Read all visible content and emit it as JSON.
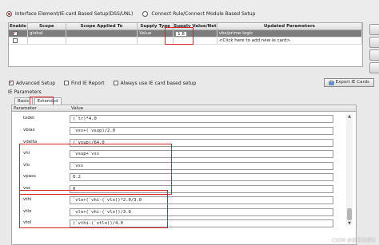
{
  "mode": {
    "option1_label": "Interface Element/IE-card Based Setup(DSS/UNL)",
    "option2_label": "Connect Rule/Connect Module Based Setup",
    "selected": "option1"
  },
  "supply_table": {
    "columns": [
      "Enable",
      "Scope",
      "Scope Applied To",
      "Supply Type",
      "Supply Value/Net",
      "Updated Parameters"
    ],
    "rows": [
      {
        "enabled": true,
        "scope": "global",
        "applied_to": "",
        "type": "Value",
        "value": "1.8",
        "updated": "vbs/prime-logic"
      },
      {
        "enabled": false,
        "scope": "",
        "applied_to": "",
        "type": "",
        "value": "",
        "updated": "<Click here to add new ie card>"
      }
    ]
  },
  "options": {
    "advanced_setup_label": "Advanced Setup",
    "advanced_setup_checked": true,
    "find_ie_report_label": "Find IE Report",
    "find_ie_report_checked": false,
    "always_use_ie_card_label": "Always use IE card based setup",
    "always_use_ie_card_checked": false,
    "export_button_label": "Export IE Cards"
  },
  "ie_parameters": {
    "section_label": "IE Parameters",
    "tabs": [
      "Basic",
      "Extended"
    ],
    "active_tab": "Extended",
    "col_parameter": "Parameter",
    "col_value": "Value",
    "rows": [
      {
        "name": "txdel",
        "value": "(`tr)*4.0"
      },
      {
        "name": "vbias",
        "value": "`vss+(`vsup)/2.0"
      },
      {
        "name": "vdelta",
        "value": "(`vsup)/64.0"
      },
      {
        "name": "vhi",
        "value": "`vsup+`vss"
      },
      {
        "name": "vlo",
        "value": "`vss"
      },
      {
        "name": "vpass",
        "value": "0.2"
      },
      {
        "name": "vss",
        "value": "0"
      },
      {
        "name": "vthi",
        "value": "`vlo+(`vhi-(`vlo))*2.0/3.0"
      },
      {
        "name": "vtlo",
        "value": "`vlo+(`vhi-(`vlo))/3.0"
      },
      {
        "name": "vtol",
        "value": "(`vthi-(`vtlo))/4.0"
      }
    ]
  },
  "watermark": "CSDN @信号完整性",
  "colors": {
    "highlight": "#d6262b",
    "selected_row": "#7d7d7d",
    "check_mark": "#c0392b"
  }
}
